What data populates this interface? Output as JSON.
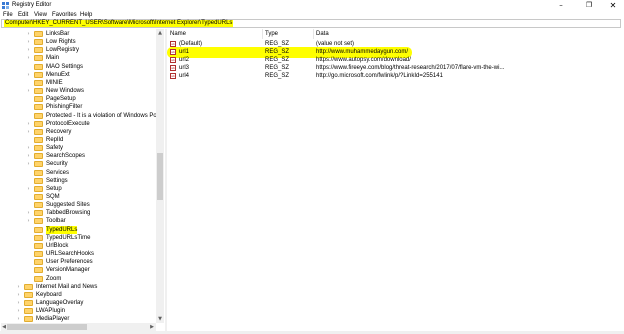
{
  "window": {
    "title": "Registry Editor",
    "icon": "registry-editor-icon",
    "minimize_glyph": "–",
    "maximize_glyph": "❐",
    "close_glyph": "✕"
  },
  "menu": [
    "File",
    "Edit",
    "View",
    "Favorites",
    "Help"
  ],
  "address": "Computer\\HKEY_CURRENT_USER\\Software\\Microsoft\\Internet Explorer\\TypedURLs",
  "tree": [
    {
      "label": "LinksBar",
      "expander": "›",
      "level": 1
    },
    {
      "label": "Low Rights",
      "expander": "›",
      "level": 1
    },
    {
      "label": "LowRegistry",
      "expander": "›",
      "level": 1
    },
    {
      "label": "Main",
      "expander": "›",
      "level": 1
    },
    {
      "label": "MAO Settings",
      "expander": "",
      "level": 1
    },
    {
      "label": "MenuExt",
      "expander": "›",
      "level": 1
    },
    {
      "label": "MINIE",
      "expander": "",
      "level": 1
    },
    {
      "label": "New Windows",
      "expander": "›",
      "level": 1
    },
    {
      "label": "PageSetup",
      "expander": "",
      "level": 1
    },
    {
      "label": "PhishingFilter",
      "expander": "",
      "level": 1
    },
    {
      "label": "Protected - It is a violation of Windows Po",
      "expander": "",
      "level": 1
    },
    {
      "label": "ProtocolExecute",
      "expander": "›",
      "level": 1
    },
    {
      "label": "Recovery",
      "expander": "›",
      "level": 1
    },
    {
      "label": "ReplId",
      "expander": "",
      "level": 1
    },
    {
      "label": "Safety",
      "expander": "›",
      "level": 1
    },
    {
      "label": "SearchScopes",
      "expander": "›",
      "level": 1
    },
    {
      "label": "Security",
      "expander": "›",
      "level": 1
    },
    {
      "label": "Services",
      "expander": "",
      "level": 1
    },
    {
      "label": "Settings",
      "expander": "",
      "level": 1
    },
    {
      "label": "Setup",
      "expander": "›",
      "level": 1
    },
    {
      "label": "SQM",
      "expander": "",
      "level": 1
    },
    {
      "label": "Suggested Sites",
      "expander": "",
      "level": 1
    },
    {
      "label": "TabbedBrowsing",
      "expander": "›",
      "level": 1
    },
    {
      "label": "Toolbar",
      "expander": "›",
      "level": 1
    },
    {
      "label": "TypedURLs",
      "expander": "",
      "level": 1,
      "selected": true
    },
    {
      "label": "TypedURLsTime",
      "expander": "",
      "level": 1
    },
    {
      "label": "UrlBlock",
      "expander": "",
      "level": 1
    },
    {
      "label": "URLSearchHooks",
      "expander": "",
      "level": 1
    },
    {
      "label": "User Preferences",
      "expander": "",
      "level": 1
    },
    {
      "label": "VersionManager",
      "expander": "",
      "level": 1
    },
    {
      "label": "Zoom",
      "expander": "",
      "level": 1
    },
    {
      "label": "Internet Mail and News",
      "expander": "›",
      "level": 0
    },
    {
      "label": "Keyboard",
      "expander": "›",
      "level": 0
    },
    {
      "label": "LanguageOverlay",
      "expander": "›",
      "level": 0
    },
    {
      "label": "LWAPlugin",
      "expander": "›",
      "level": 0
    },
    {
      "label": "MediaPlayer",
      "expander": "›",
      "level": 0
    }
  ],
  "columns": {
    "name": "Name",
    "type": "Type",
    "data": "Data"
  },
  "values": [
    {
      "name": "(Default)",
      "type": "REG_SZ",
      "data": "(value not set)",
      "icon": "ab-string-icon"
    },
    {
      "name": "url1",
      "type": "REG_SZ",
      "data": "http://www.muhammedaygun.com/",
      "icon": "ab-string-icon",
      "highlighted": true
    },
    {
      "name": "url2",
      "type": "REG_SZ",
      "data": "https://www.autopsy.com/download/",
      "icon": "ab-string-icon"
    },
    {
      "name": "url3",
      "type": "REG_SZ",
      "data": "https://www.fireeye.com/blog/threat-research/2017/07/flare-vm-the-wi...",
      "icon": "ab-string-icon"
    },
    {
      "name": "url4",
      "type": "REG_SZ",
      "data": "http://go.microsoft.com/fwlink/p/?LinkId=255141",
      "icon": "ab-string-icon"
    }
  ],
  "icon_glyph": "ab",
  "colors": {
    "highlight": "#ffff00",
    "folder": "#ffd36a"
  }
}
